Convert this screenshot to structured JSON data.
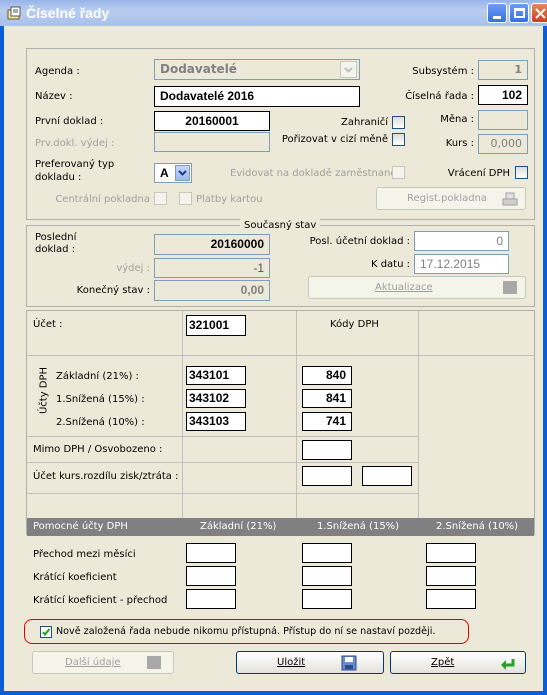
{
  "window": {
    "title": "Číselné řady"
  },
  "form": {
    "agenda_label": "Agenda :",
    "agenda_value": "Dodavatelé",
    "subsystem_label": "Subsystém :",
    "subsystem_value": "1",
    "nazev_label": "Název :",
    "nazev_value": "Dodavatelé 2016",
    "ciselna_rada_label": "Číselná řada :",
    "ciselna_rada_value": "102",
    "prvni_doklad_label": "První doklad :",
    "prvni_doklad_value": "20160001",
    "zahranici_label": "Zahraničí",
    "mena_label": "Měna :",
    "prv_dokl_vydej_label": "Prv.dokl. výdej :",
    "porizovat_label": "Pořizovat v cizí měně",
    "kurs_label": "Kurs :",
    "kurs_value": "0,000",
    "pref_typ_label": "Preferovaný  typ dokladu :",
    "pref_typ_value": "A",
    "evidovat_label": "Evidovat na dokladě zaměstnance",
    "vraceni_dph_label": "Vrácení DPH",
    "centralni_pokladna_label": "Centrální pokladna",
    "platby_kartou_label": "Platby kartou",
    "regist_pokladna_label": "Regist.pokladna"
  },
  "current_state": {
    "title": "Současný stav",
    "posledni_doklad_label": "Poslední doklad :",
    "posledni_doklad_value": "20160000",
    "vydej_label": "výdej :",
    "vydej_value": "-1",
    "konecny_stav_label": "Konečný stav :",
    "konecny_stav_value": "0,00",
    "posl_ucetni_label": "Posl. účetní doklad :",
    "posl_ucetni_value": "0",
    "k_datu_label": "K datu :",
    "k_datu_value": "17.12.2015",
    "aktualizace_label": "Aktualizace"
  },
  "accounts": {
    "ucet_label": "Účet :",
    "ucet_value": "321001",
    "kody_dph_label": "Kódy DPH",
    "ucty_dph_label": "Účty DPH",
    "rows": [
      {
        "label": "Základní (21%) :",
        "account": "343101",
        "code": "840"
      },
      {
        "label": "1.Snížená (15%) :",
        "account": "343102",
        "code": "841"
      },
      {
        "label": "2.Snížená (10%) :",
        "account": "343103",
        "code": "741"
      }
    ],
    "mimo_dph_label": "Mimo DPH / Osvobozeno :",
    "kurs_rozdil_label": "Účet kurs.rozdílu zisk/ztráta :"
  },
  "aux": {
    "header": [
      "Pomocné účty DPH",
      "Základní (21%)",
      "1.Snížená (15%)",
      "2.Snížená (10%)"
    ],
    "rows": [
      "Přechod mezi měsíci",
      "Krátící koeficient",
      "Krátící koeficient - přechod"
    ]
  },
  "notice": {
    "text": "Nově založená řada nebude nikomu přístupná. Přístup do ní se nastaví později."
  },
  "buttons": {
    "dalsi_udaje": "Další údaje",
    "ulozit": "Uložit",
    "zpet": "Zpět"
  },
  "colors": {
    "titlebar": "#0a246a",
    "grey_band": "#808080",
    "notice_border": "#e00000"
  }
}
